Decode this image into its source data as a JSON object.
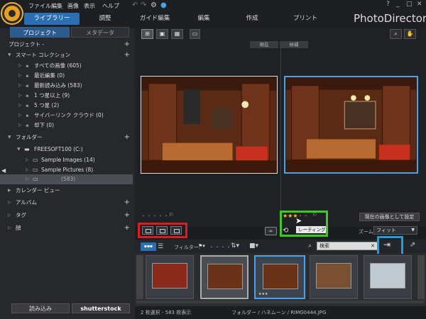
{
  "app": {
    "name": "PhotoDirector"
  },
  "menu": [
    "ファイル",
    "編集",
    "画像",
    "表示",
    "ヘルプ"
  ],
  "window_controls": [
    "?",
    "_",
    "□",
    "✕"
  ],
  "mode_tabs": [
    "ライブラリー",
    "調整",
    "ガイド編集",
    "編集",
    "作成",
    "プリント"
  ],
  "panel_tabs": [
    "プロジェクト",
    "メタデータ"
  ],
  "tree": {
    "project": "プロジェクト -",
    "smart_collection": "スマート コレクション",
    "smart_items": [
      "すべての画像 (605)",
      "最近編集 (0)",
      "最新読み込み (583)",
      "1 つ星以上 (9)",
      "5 つ星 (2)",
      "サイバーリンク クラウド (0)",
      "却下 (0)"
    ],
    "folder": "フォルダー",
    "drive": "FREESOFT100 (C:)",
    "subfolders": [
      "Sample Images (14)",
      "Sample Pictures (8)"
    ],
    "selected_count": "(583)",
    "calendar": "カレンダー ビュー",
    "album": "アルバム",
    "tag": "タグ",
    "face": "顔"
  },
  "view": {
    "label_current": "現在",
    "label_candidate": "候補",
    "set_current": "現在の画像として設定",
    "zoom_label": "ズーム:",
    "zoom_value": "フィット",
    "tooltip": "レーティング",
    "rating_dots": "・・・・・",
    "stars": "★★★"
  },
  "toolbar2": {
    "filter": "フィルター:",
    "filter_dots": "・・・・",
    "search_placeholder": "検索"
  },
  "statusbar": {
    "left": "2 枚選択 - 583 枚表示",
    "right": "フォルダー / ハネムーン / RIMG0444.JPG"
  },
  "bottom_buttons": {
    "import": "読み込み",
    "shutterstock": "shutterstock"
  },
  "colors": {
    "accent": "#2a6fb4",
    "red_box": "#e21a1a",
    "green_box": "#3bcc1f",
    "blue_box": "#1aa0e0"
  }
}
